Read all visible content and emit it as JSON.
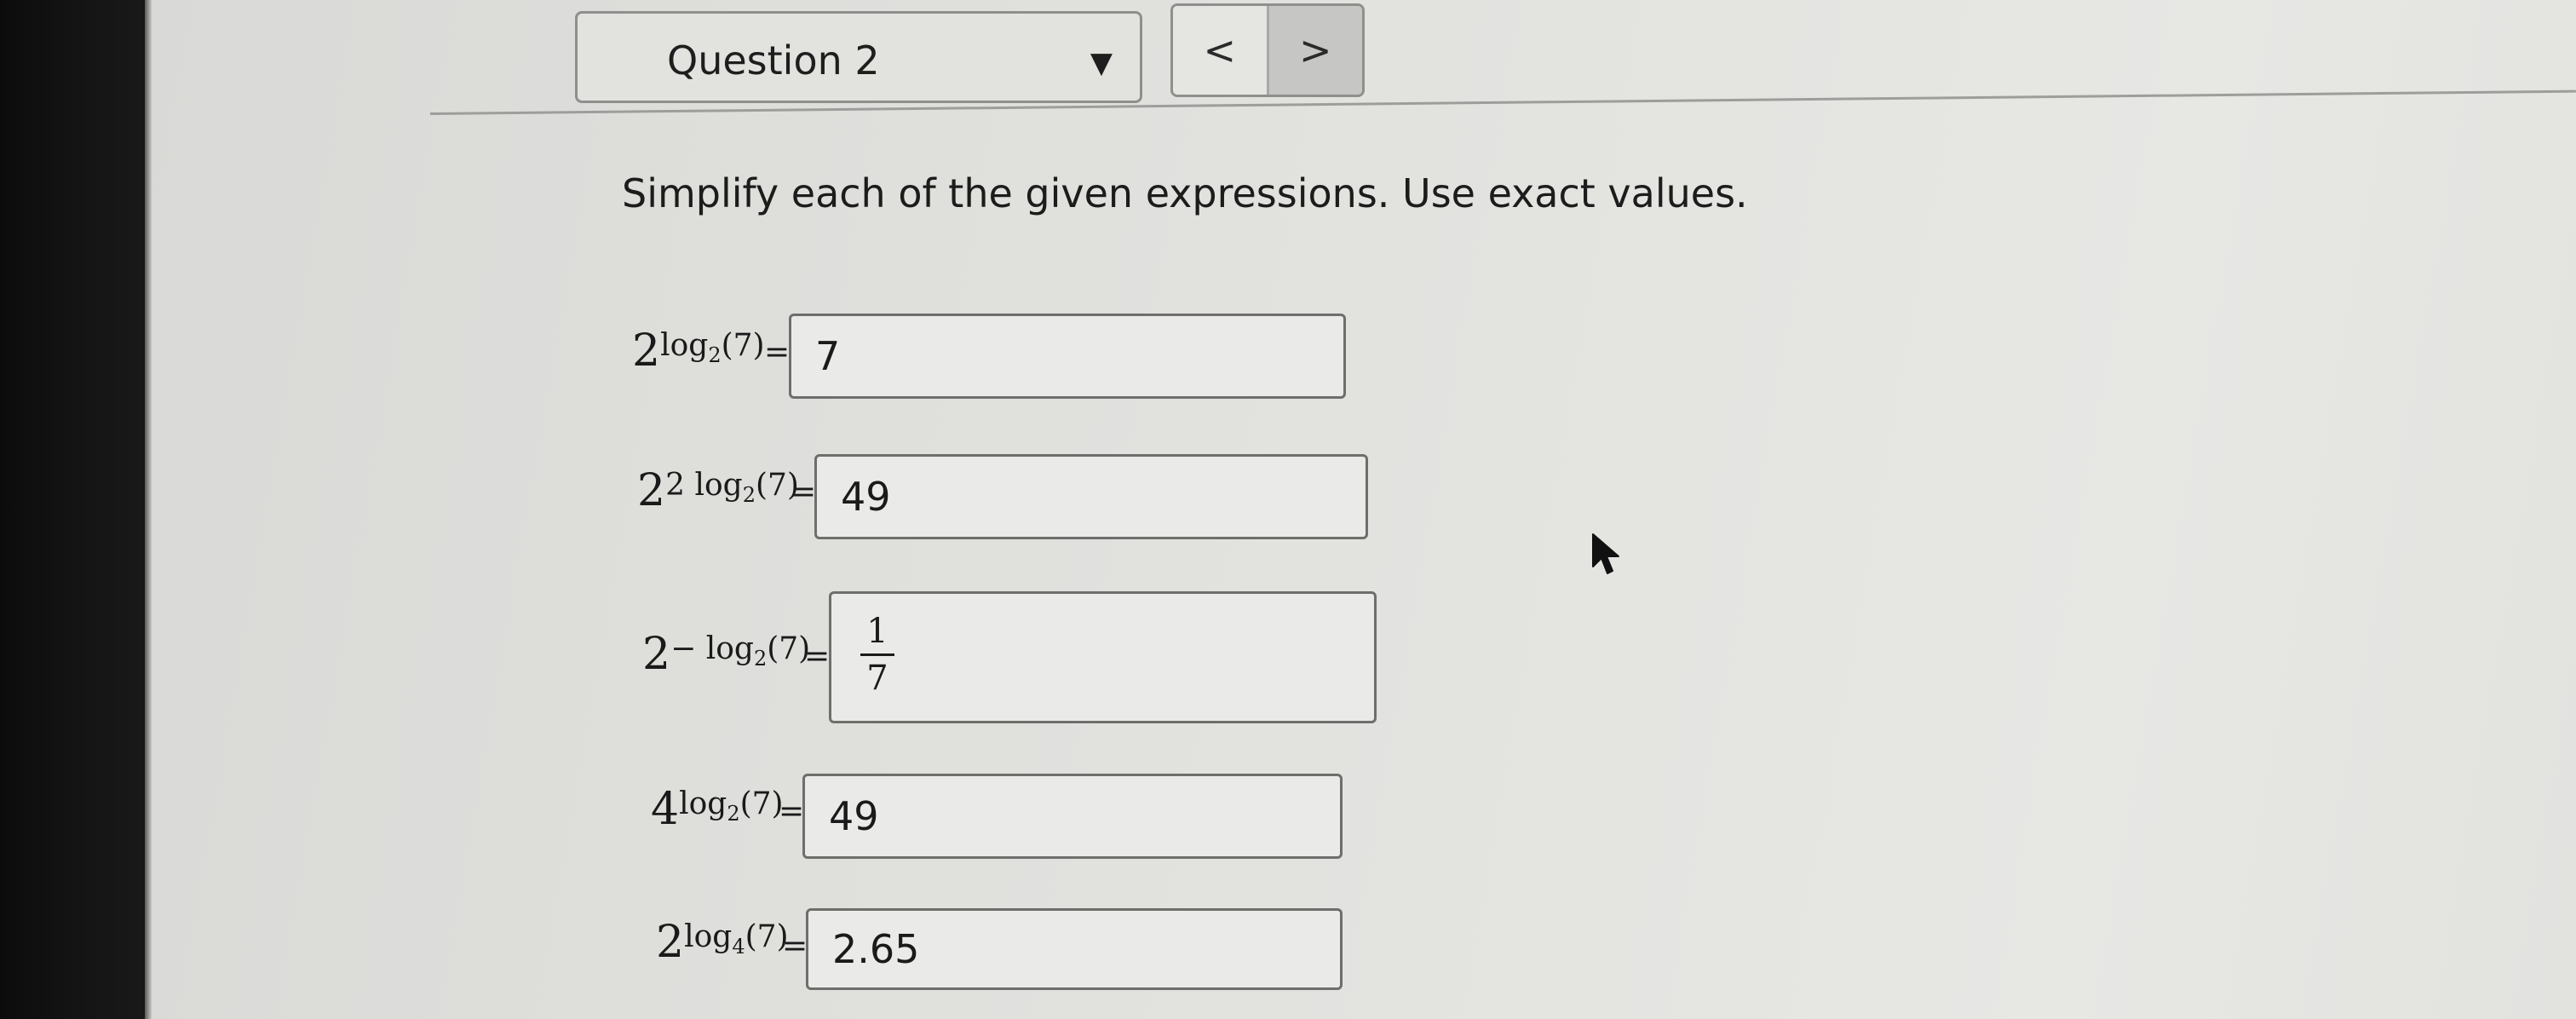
{
  "question_selector": {
    "label": "Question 2",
    "caret": "▼"
  },
  "nav": {
    "prev": "<",
    "next": ">"
  },
  "instructions": "Simplify each of the given expressions. Use exact values.",
  "problems": [
    {
      "base": "2",
      "exp_prefix": "log",
      "exp_sub": "2",
      "exp_arg": "(7)",
      "equals": "=",
      "answer": "7"
    },
    {
      "base": "2",
      "exp_prefix": "2 log",
      "exp_sub": "2",
      "exp_arg": "(7)",
      "equals": "=",
      "answer": "49"
    },
    {
      "base": "2",
      "exp_prefix": "− log",
      "exp_sub": "2",
      "exp_arg": "(7)",
      "equals": "=",
      "answer_numerator": "1",
      "answer_denominator": "7"
    },
    {
      "base": "4",
      "exp_prefix": "log",
      "exp_sub": "2",
      "exp_arg": "(7)",
      "equals": "=",
      "answer": "49"
    },
    {
      "base": "2",
      "exp_prefix": "log",
      "exp_sub": "4",
      "exp_arg": "(7)",
      "equals": "=",
      "answer": "2.65"
    }
  ],
  "icons": {
    "dropdown": "caret-down-icon",
    "prev": "chevron-left-icon",
    "next": "chevron-right-icon",
    "cursor": "mouse-pointer-icon"
  },
  "colors": {
    "screen_bg": "#e0e0dd",
    "bezel": "#141414",
    "input_border": "#6e6e6c",
    "text": "#1a1a1a",
    "next_button_bg": "#c6c6c4"
  }
}
